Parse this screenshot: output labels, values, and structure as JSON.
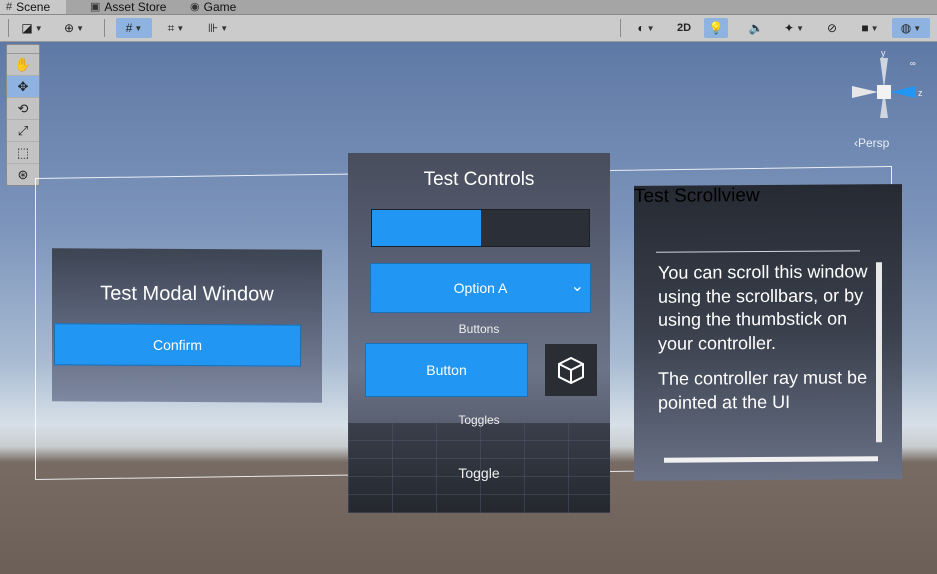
{
  "tabs": [
    {
      "label": "Scene",
      "icon": "hash-icon"
    },
    {
      "label": "Asset Store",
      "icon": "store-icon"
    },
    {
      "label": "Game",
      "icon": "gamepad-icon"
    }
  ],
  "toolbar": {
    "mode_2d": "2D"
  },
  "gizmo": {
    "axis_y": "y",
    "axis_z": "z",
    "projection": "Persp"
  },
  "modal": {
    "title": "Test Modal Window",
    "confirm_label": "Confirm"
  },
  "controls": {
    "title": "Test Controls",
    "progress": 0.5,
    "dropdown_value": "Option A",
    "buttons_label": "Buttons",
    "button_label": "Button",
    "toggles_label": "Toggles",
    "toggle_label": "Toggle"
  },
  "scrollview": {
    "title": "Test Scrollview",
    "paragraph_1": "You can scroll this window using the scrollbars, or by using the thumbstick on your controller.",
    "paragraph_2": "The controller ray must be pointed at the UI"
  },
  "colors": {
    "accent": "#2196f3",
    "selection": "#8fb3e0"
  }
}
